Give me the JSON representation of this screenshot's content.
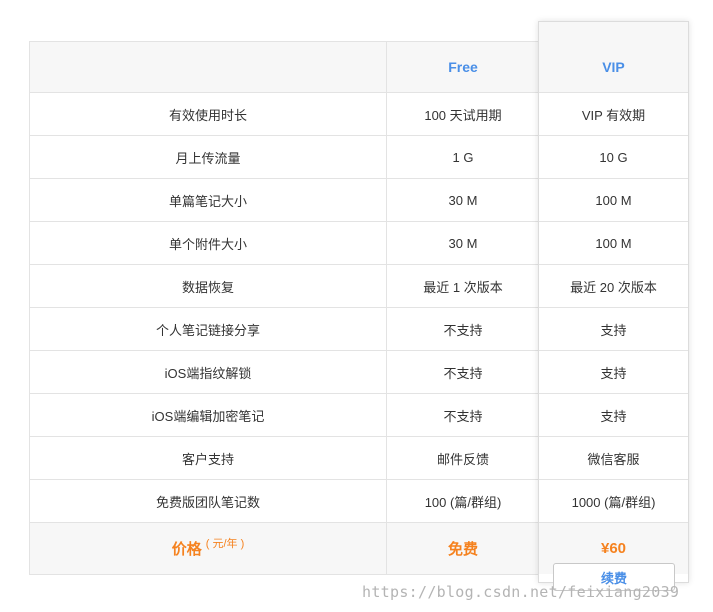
{
  "plans": {
    "free": "Free",
    "vip": "VIP"
  },
  "features": [
    {
      "label": "有效使用时长",
      "free": "100 天试用期",
      "vip": "VIP 有效期"
    },
    {
      "label": "月上传流量",
      "free": "1 G",
      "vip": "10 G"
    },
    {
      "label": "单篇笔记大小",
      "free": "30 M",
      "vip": "100 M"
    },
    {
      "label": "单个附件大小",
      "free": "30 M",
      "vip": "100 M"
    },
    {
      "label": "数据恢复",
      "free": "最近 1 次版本",
      "vip": "最近 20 次版本"
    },
    {
      "label": "个人笔记链接分享",
      "free": "不支持",
      "vip": "支持"
    },
    {
      "label": "iOS端指纹解锁",
      "free": "不支持",
      "vip": "支持"
    },
    {
      "label": "iOS端编辑加密笔记",
      "free": "不支持",
      "vip": "支持"
    },
    {
      "label": "客户支持",
      "free": "邮件反馈",
      "vip": "微信客服"
    },
    {
      "label": "免费版团队笔记数",
      "free": "100 (篇/群组)",
      "vip": "1000 (篇/群组)"
    }
  ],
  "price": {
    "label": "价格",
    "unit": "( 元/年 )",
    "free": "免费",
    "vip": "¥60"
  },
  "renew_label": "续费",
  "watermark": "https://blog.csdn.net/feixiang2039",
  "colors": {
    "accent_blue": "#4a8fe7",
    "price_orange": "#f5821f"
  }
}
